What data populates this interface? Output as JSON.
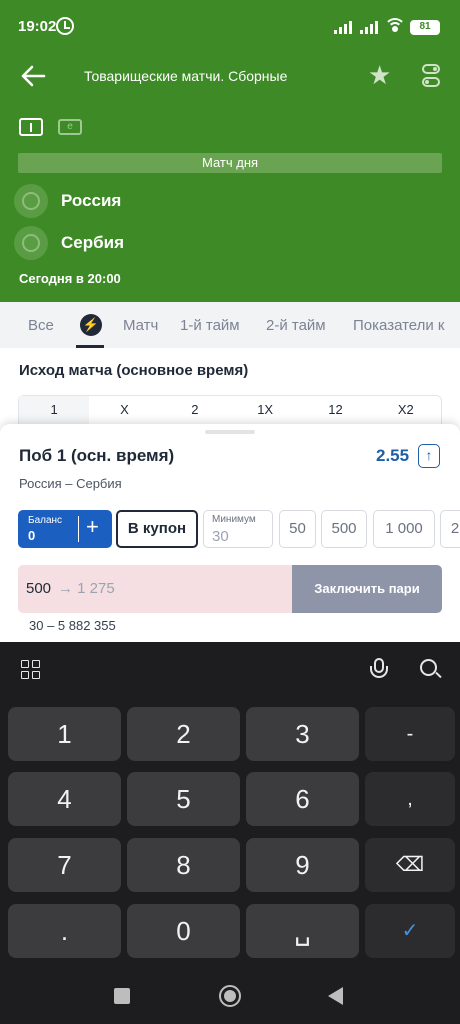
{
  "status": {
    "time": "19:02",
    "battery": "81"
  },
  "header": {
    "title": "Товарищеские матчи. Сборные"
  },
  "event": {
    "banner": "Матч дня",
    "team1": "Россия",
    "team2": "Сербия",
    "start": "Сегодня в 20:00"
  },
  "tabs": [
    "Все",
    "Матч",
    "1-й тайм",
    "2-й тайм",
    "Показатели к"
  ],
  "market": {
    "title": "Исход матча (основное время)",
    "outcomes": [
      "1",
      "X",
      "2",
      "1X",
      "12",
      "X2"
    ]
  },
  "betslip": {
    "title": "Поб 1 (осн. время)",
    "odds": "2.55",
    "odds_arrow": "↑",
    "match": "Россия – Сербия",
    "balance_label": "Баланс",
    "balance_value": "0",
    "plus": "+",
    "coupon_label": "В купон",
    "min_label": "Минимум",
    "min_value": "30",
    "quick": [
      "50",
      "500",
      "1 000",
      "2"
    ],
    "stake_value": "500",
    "win_value": "→ 1 275",
    "place_label": "Заключить пари",
    "range": "30 – 5 882 355"
  },
  "keyboard": {
    "keys": [
      "1",
      "2",
      "3",
      "-",
      "4",
      "5",
      "6",
      ",",
      "7",
      "8",
      "9",
      "⌫",
      ".",
      "0",
      "␣",
      "✓"
    ]
  },
  "colors": {
    "brand_green": "#3e8a26",
    "accent_blue": "#1b5fc1"
  }
}
